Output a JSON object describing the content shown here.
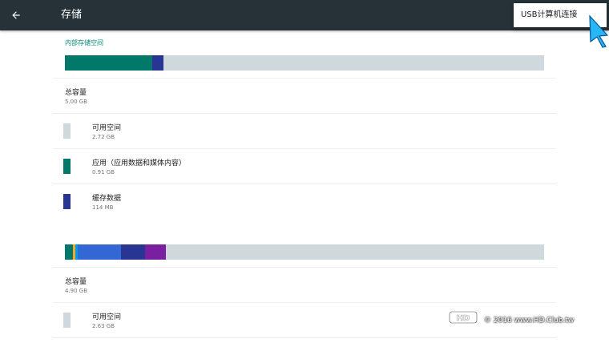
{
  "appbar": {
    "title": "存储"
  },
  "menu": {
    "item_label": "USB计算机连接"
  },
  "internal_storage": {
    "header": "内部存储空间",
    "bar_segments": [
      {
        "name": "apps",
        "fraction": 0.182,
        "color": "#00796b"
      },
      {
        "name": "cache",
        "fraction": 0.023,
        "color": "#283593"
      }
    ],
    "total": {
      "title": "总容量",
      "value": "5.00 GB"
    },
    "items": [
      {
        "title": "可用空间",
        "value": "2.72 GB",
        "color": "#cfd8dc"
      },
      {
        "title": "应用（应用数据和媒体内容）",
        "value": "0.91 GB",
        "color": "#00796b"
      },
      {
        "title": "缓存数据",
        "value": "114 MB",
        "color": "#283593"
      }
    ]
  },
  "secondary_storage": {
    "bar_segments": [
      {
        "name": "apps",
        "fraction": 0.017,
        "color": "#00796b"
      },
      {
        "name": "misc1",
        "fraction": 0.005,
        "color": "#f9a825"
      },
      {
        "name": "misc2",
        "fraction": 0.005,
        "color": "#039be5"
      },
      {
        "name": "pictures",
        "fraction": 0.09,
        "color": "#3367d6"
      },
      {
        "name": "cache",
        "fraction": 0.05,
        "color": "#283593"
      },
      {
        "name": "other",
        "fraction": 0.043,
        "color": "#7b1fa2"
      }
    ],
    "total": {
      "title": "总容量",
      "value": "4.90 GB"
    },
    "items": [
      {
        "title": "可用空间",
        "value": "2.63 GB",
        "color": "#cfd8dc"
      }
    ]
  },
  "watermark": {
    "text": "© 2016  www.HD.Club.tw"
  }
}
